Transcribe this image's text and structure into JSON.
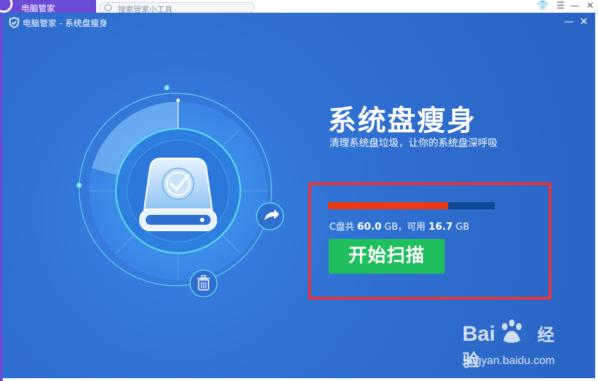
{
  "host": {
    "title": "电脑管家",
    "search_placeholder": "搜索管家小工具",
    "controls": [
      "👕",
      "☰",
      "—",
      "✕"
    ]
  },
  "dialog": {
    "title": "电脑管家 - 系统盘瘦身",
    "minimize": "—",
    "close": "✕"
  },
  "hero": {
    "title": "系统盘瘦身",
    "subtitle": "清理系统盘垃圾，让你的系统盘深呼吸"
  },
  "disk": {
    "drive_label": "C盘共",
    "total": "60.0",
    "unit": "GB",
    "available_label": "，可用",
    "available": "16.7",
    "used_fraction": 0.72
  },
  "actions": {
    "scan": "开始扫描"
  },
  "watermark": {
    "brand_left": "Bai",
    "brand_mid": "du",
    "brand_right": "经验",
    "url": "jingyan.baidu.com"
  },
  "colors": {
    "background": "#2f6fd0",
    "accent_green": "#1fbf5e",
    "usage_fill": "#ee3a14",
    "usage_track": "#0f4896",
    "highlight": "#e8343a"
  }
}
